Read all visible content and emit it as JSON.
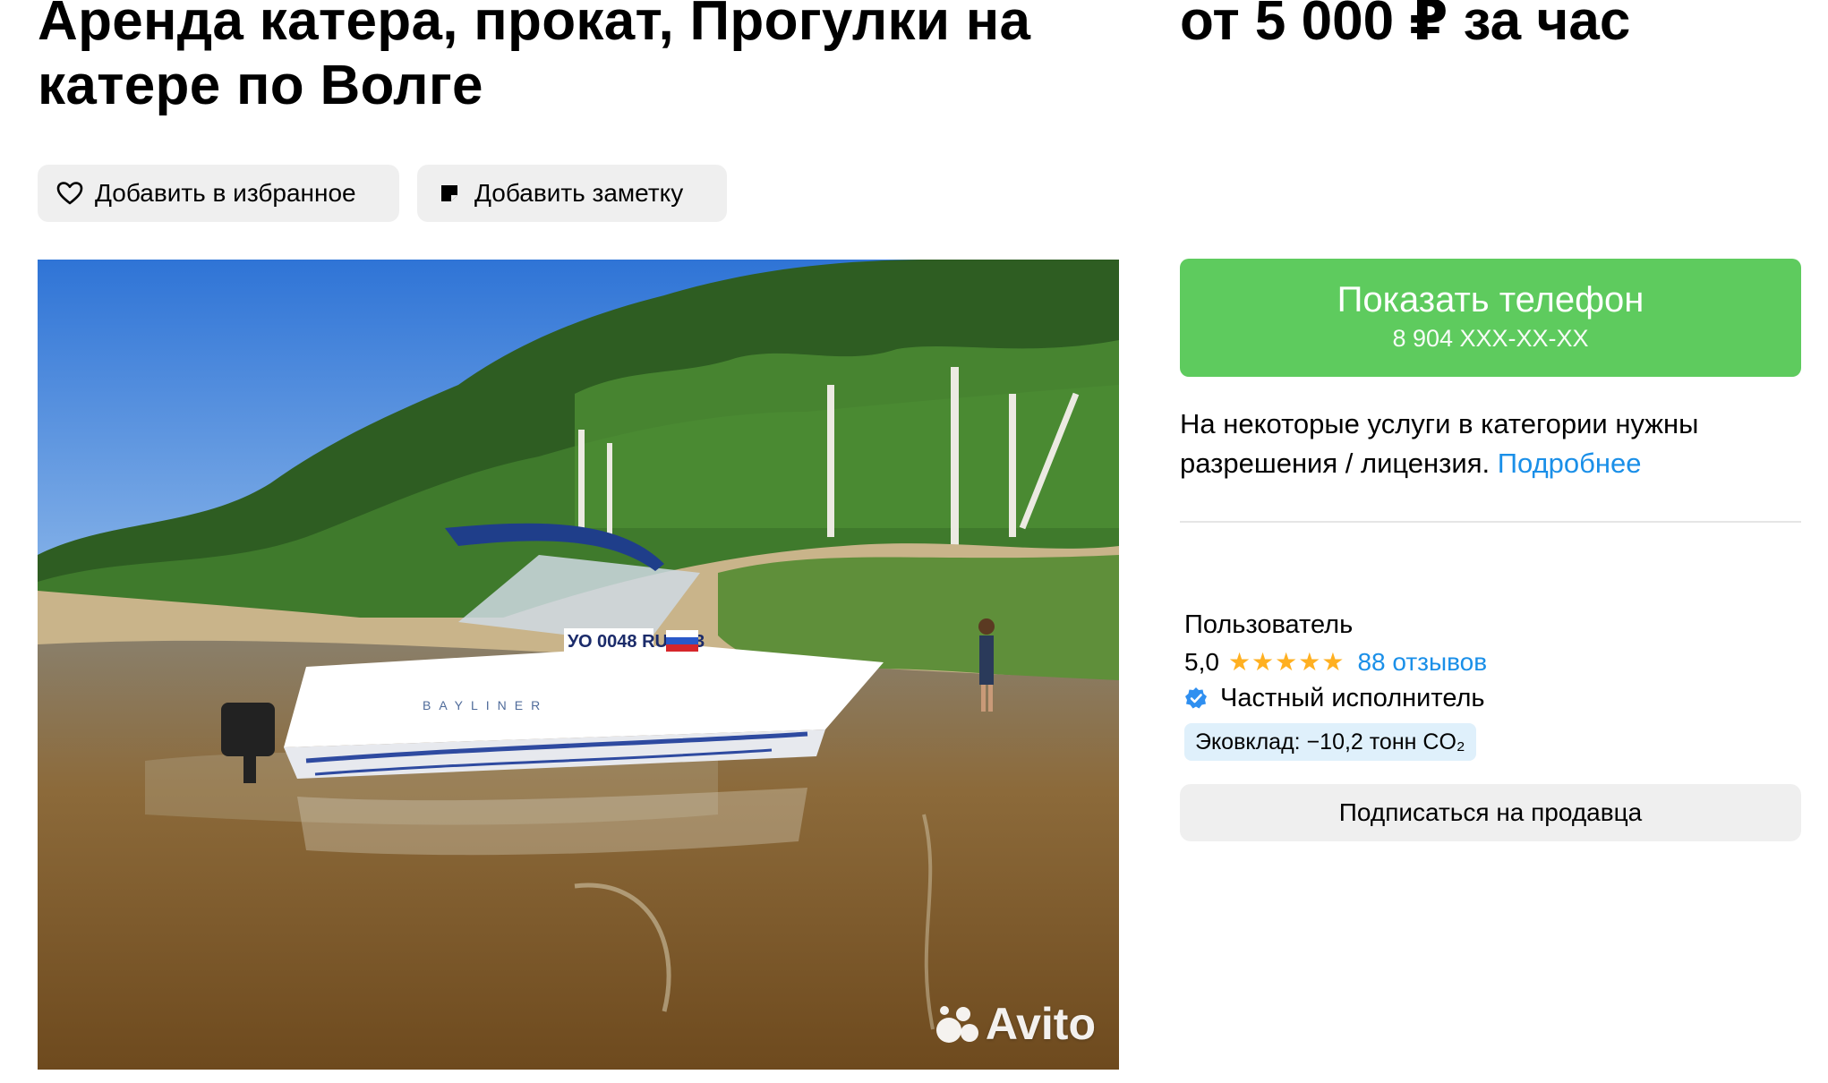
{
  "listing": {
    "title": "Аренда катера, прокат, Прогулки на катере по Волге",
    "price": "от 5 000 ₽ за час"
  },
  "actions": {
    "favorite_label": "Добавить в избранное",
    "note_label": "Добавить заметку"
  },
  "gallery": {
    "watermark": "Avito",
    "boat_registration": "УО 0048 RUS 73",
    "boat_brand": "BAYLINER"
  },
  "contact": {
    "show_phone_label": "Показать телефон",
    "phone_masked": "8 904 XXX-XX-XX"
  },
  "license_notice": {
    "text": "На некоторые услуги в категории нужны разрешения / лицензия.",
    "link": "Подробнее"
  },
  "seller": {
    "name": "Пользователь",
    "rating": "5,0",
    "stars": "★★★★★",
    "reviews": "88 отзывов",
    "type": "Частный исполнитель",
    "eco_contribution": "Эковклад: −10,2 тонн CO₂",
    "subscribe_label": "Подписаться на продавца"
  },
  "colors": {
    "accent_green": "#5ecb5e",
    "link_blue": "#1a8fe8",
    "star_orange": "#ffb021",
    "button_gray": "#efefef",
    "eco_badge_bg": "#dff0fb"
  },
  "icons": {
    "favorite": "heart-icon",
    "note": "note-icon",
    "verified": "verified-check-icon",
    "watermark": "avito-logo-icon"
  }
}
